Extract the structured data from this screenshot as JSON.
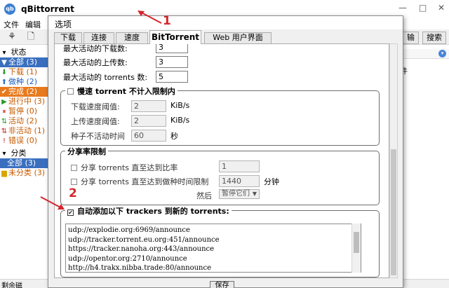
{
  "app": {
    "title": "qBittorrent",
    "logo_text": "qb",
    "menu": [
      "文件",
      "编辑"
    ],
    "toolbar_buttons": [
      "输",
      "搜索"
    ],
    "right_column_label": "件"
  },
  "window_controls": {
    "minimize": "—",
    "maximize": "□",
    "close": "✕"
  },
  "sidebar": {
    "status_header": "状态",
    "items": [
      {
        "label": "全部 (3)",
        "icon": "▼"
      },
      {
        "label": "下载 (1)",
        "icon": "⬇"
      },
      {
        "label": "做种 (2)",
        "icon": "⬆"
      },
      {
        "label": "完成 (2)",
        "icon": "✔"
      },
      {
        "label": "进行中 (3)",
        "icon": "▶"
      },
      {
        "label": "暂停 (0)",
        "icon": "⏸"
      },
      {
        "label": "活动 (2)",
        "icon": "⇅"
      },
      {
        "label": "非活动 (1)",
        "icon": "⇅"
      },
      {
        "label": "错误 (0)",
        "icon": "!"
      }
    ],
    "category_header": "分类",
    "categories": [
      {
        "label": "全部 (3)"
      },
      {
        "label": "未分类 (3)"
      }
    ]
  },
  "statusbar": {
    "left_text": "剩余磁"
  },
  "dialog": {
    "title": "选项",
    "tabs": [
      {
        "label": "下载",
        "active": false
      },
      {
        "label": "连接",
        "active": false
      },
      {
        "label": "速度",
        "active": false
      },
      {
        "label": "BitTorrent",
        "active": true
      },
      {
        "label": "Web 用户界面",
        "active": false
      }
    ],
    "queue": {
      "max_active_downloads_label": "最大活动的下载数:",
      "max_active_downloads": "3",
      "max_active_uploads_label": "最大活动的上传数:",
      "max_active_uploads": "3",
      "max_active_torrents_label": "最大活动的 torrents 数:",
      "max_active_torrents": "5"
    },
    "slow_torrents": {
      "title": "慢速 torrent 不计入限制内",
      "download_rate_label": "下载速度阈值:",
      "download_rate": "2",
      "download_unit": "KiB/s",
      "upload_rate_label": "上传速度阈值:",
      "upload_rate": "2",
      "upload_unit": "KiB/s",
      "inactive_timer_label": "种子不活动时间",
      "inactive_timer": "60",
      "inactive_unit": "秒"
    },
    "share_ratio": {
      "title": "分享率限制",
      "ratio_label": "分享 torrents 直至达到比率",
      "ratio_value": "1",
      "seed_time_label": "分享 torrents 直至达到做种时间限制",
      "seed_time_value": "1440",
      "seed_time_unit": "分钟",
      "then_label": "然后",
      "then_action": "暂停它们"
    },
    "auto_trackers": {
      "title": "自动添加以下 trackers 到新的 torrents:",
      "trackers": [
        "udp://explodie.org:6969/announce",
        "udp://tracker.torrent.eu.org:451/announce",
        "https://tracker.nanoha.org:443/announce",
        "udp://opentor.org:2710/announce",
        "http://h4.trakx.nibba.trade:80/announce"
      ]
    },
    "save_label": "保存"
  },
  "annotations": {
    "one": "1",
    "two": "2",
    "color": "#d4262d"
  }
}
